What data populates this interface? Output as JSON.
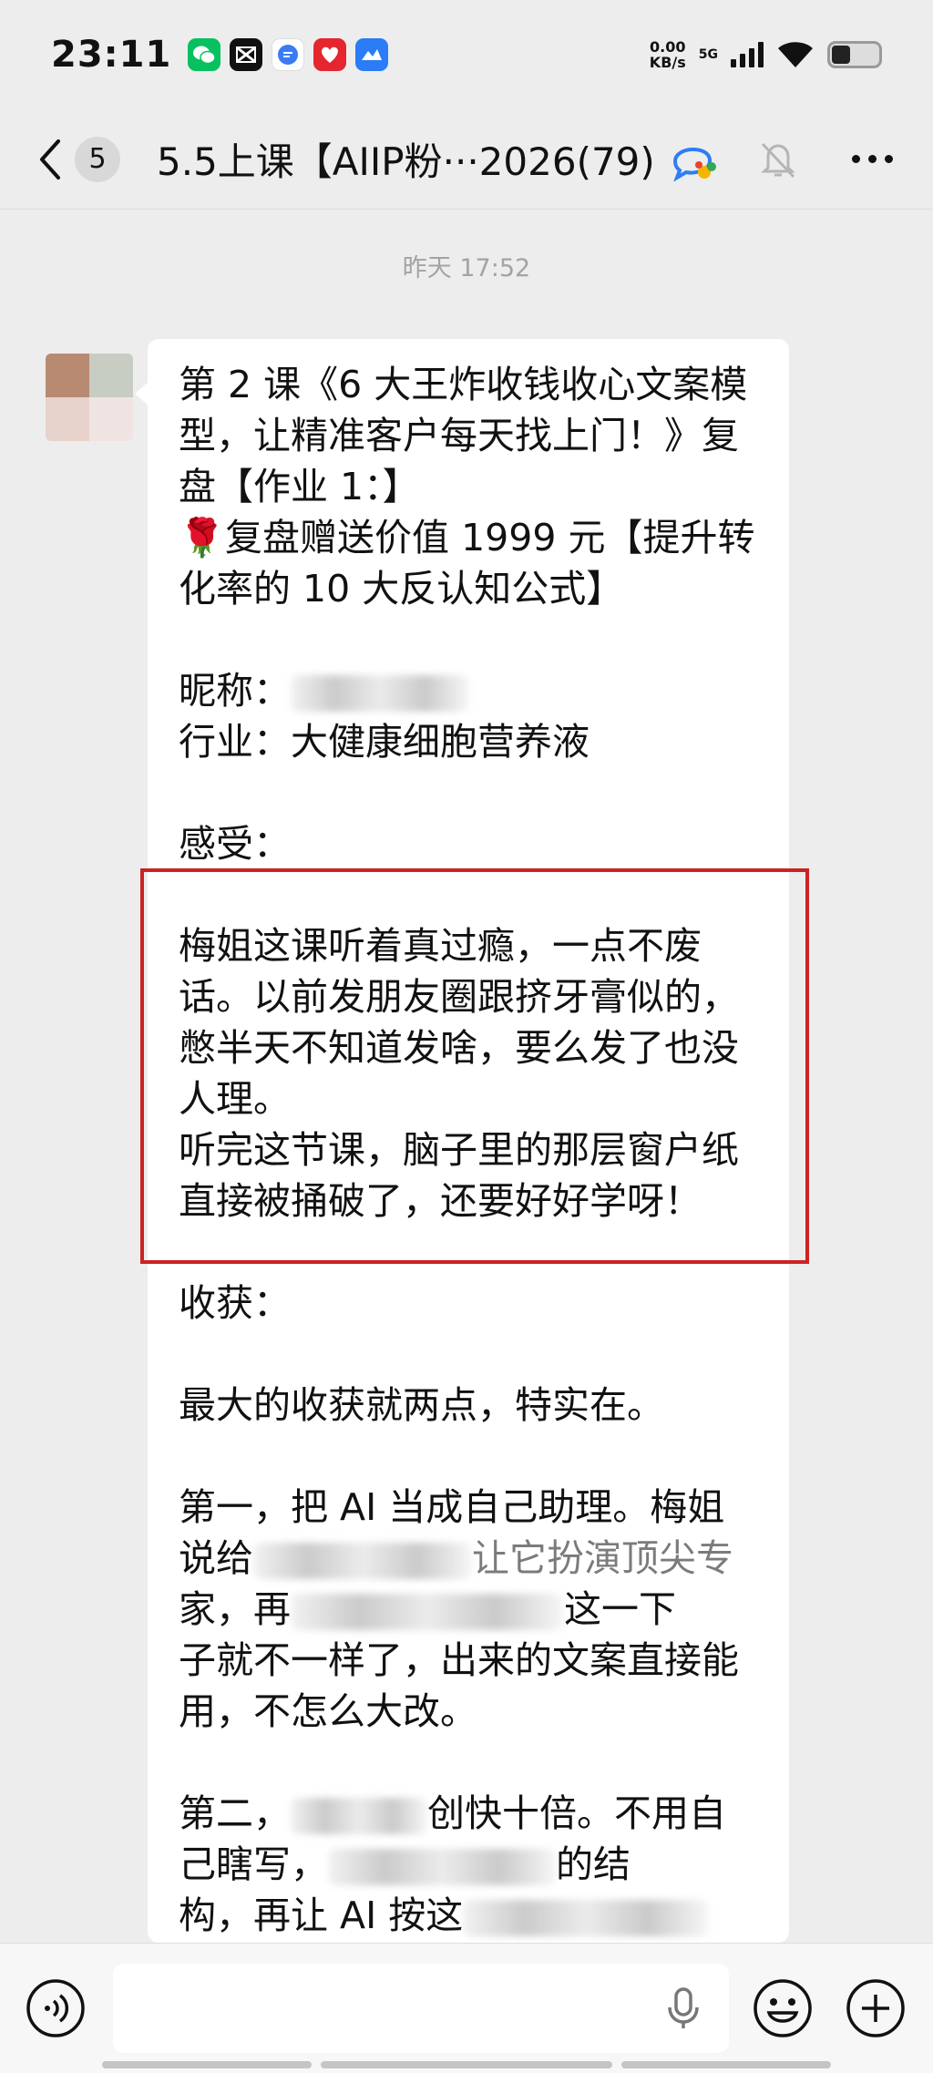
{
  "status_bar": {
    "time": "23:11",
    "net_speed_value": "0.00",
    "net_speed_unit": "KB/s",
    "network": "5G",
    "app_icons": [
      {
        "name": "wechat-app-icon",
        "color": "#07c160"
      },
      {
        "name": "capcut-app-icon",
        "color": "#111111"
      },
      {
        "name": "chat-app-icon",
        "color": "#3a7bf5"
      },
      {
        "name": "red-app-icon",
        "color": "#e5262f"
      },
      {
        "name": "lark-app-icon",
        "color": "#2b7cf6"
      }
    ]
  },
  "header": {
    "unread_count": "5",
    "title": "5.5上课【AIIP粉···2026(79)",
    "group_icon": "group-chat-icon",
    "mute_icon": "mute-bell-icon",
    "more_icon": "more-icon"
  },
  "chat": {
    "timestamp": "昨天 17:52",
    "message": {
      "lines": [
        "第 2 课《6 大王炸收钱收心文案模",
        "型，让精准客户每天找上门！》复",
        "盘【作业 1：】",
        "🌹复盘赠送价值 1999 元【提升转",
        "化率的 10 大反认知公式】",
        "",
        "昵称：",
        "行业：大健康细胞营养液",
        "",
        "感受：",
        "",
        "梅姐这课听着真过瘾，一点不废",
        "话。以前发朋友圈跟挤牙膏似的，",
        "憋半天不知道发啥，要么发了也没",
        "人理。",
        "听完这节课，脑子里的那层窗户纸",
        "直接被捅破了，还要好好学呀！",
        "收获：",
        "",
        "最大的收获就两点，特实在。",
        "",
        "第一，把 AI 当成自己助理。梅姐",
        "说给",
        "家，再",
        "子就不一样了，出来的文案直接能",
        "用，不怎么大改。",
        "",
        "第二，",
        "己瞎写，",
        "构，再让 AI 按这"
      ],
      "partial_segments": {
        "line22_tail": "让它扮演顶尖专",
        "line23_tail": "这一下",
        "line27_tail": "创快十倍。不用自",
        "line28_tail": "的结"
      }
    }
  },
  "input_bar": {
    "placeholder": "",
    "voice_icon": "voice-input-icon",
    "mic_icon": "microphone-icon",
    "emoji_icon": "emoji-icon",
    "plus_icon": "plus-icon"
  },
  "colors": {
    "background": "#ededed",
    "bubble": "#ffffff",
    "highlight": "#cc2222",
    "timestamp": "#a3a3a3"
  }
}
